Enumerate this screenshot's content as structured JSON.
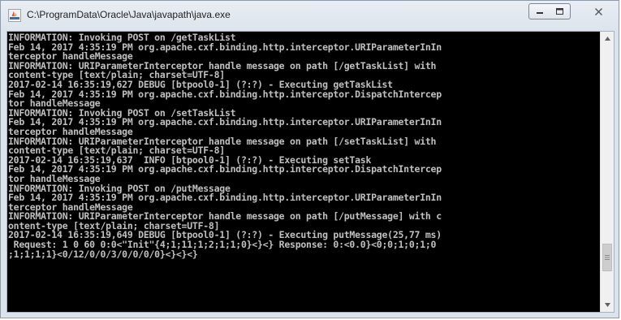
{
  "window": {
    "title": "C:\\ProgramData\\Oracle\\Java\\javapath\\java.exe",
    "icon": "java-app-icon",
    "controls": {
      "minimize": "minimize-icon",
      "maximize": "maximize-icon",
      "close": "close-icon"
    }
  },
  "console": {
    "background": "#000000",
    "foreground": "#c0c0c0",
    "lines": [
      "INFORMATION: Invoking POST on /getTaskList",
      "Feb 14, 2017 4:35:19 PM org.apache.cxf.binding.http.interceptor.URIParameterInIn",
      "terceptor handleMessage",
      "INFORMATION: URIParameterInterceptor handle message on path [/getTaskList] with",
      "content-type [text/plain; charset=UTF-8]",
      "2017-02-14 16:35:19,627 DEBUG [btpool0-1] (?:?) - Executing getTaskList",
      "Feb 14, 2017 4:35:19 PM org.apache.cxf.binding.http.interceptor.DispatchIntercep",
      "tor handleMessage",
      "INFORMATION: Invoking POST on /setTaskList",
      "Feb 14, 2017 4:35:19 PM org.apache.cxf.binding.http.interceptor.URIParameterInIn",
      "terceptor handleMessage",
      "INFORMATION: URIParameterInterceptor handle message on path [/setTaskList] with",
      "content-type [text/plain; charset=UTF-8]",
      "2017-02-14 16:35:19,637  INFO [btpool0-1] (?:?) - Executing setTask",
      "Feb 14, 2017 4:35:19 PM org.apache.cxf.binding.http.interceptor.DispatchIntercep",
      "tor handleMessage",
      "INFORMATION: Invoking POST on /putMessage",
      "Feb 14, 2017 4:35:19 PM org.apache.cxf.binding.http.interceptor.URIParameterInIn",
      "terceptor handleMessage",
      "INFORMATION: URIParameterInterceptor handle message on path [/putMessage] with c",
      "ontent-type [text/plain; charset=UTF-8]",
      "2017-02-14 16:35:19,649 DEBUG [btpool0-1] (?:?) - Executing putMessage(25,77 ms)",
      " Request: 1 0 60 0:0<\"Init\"{4;1;11;1;2;1;1;0}<}<} Response: 0:<0.0}<0;0;1;0;1;0",
      ";1;1;1;1}<0/12/0/0/3/0/0/0/0}<}<}<}"
    ]
  },
  "scrollbar": {
    "up_icon": "scroll-up-arrow-icon",
    "down_icon": "scroll-down-arrow-icon",
    "position_fraction": 0.88
  }
}
